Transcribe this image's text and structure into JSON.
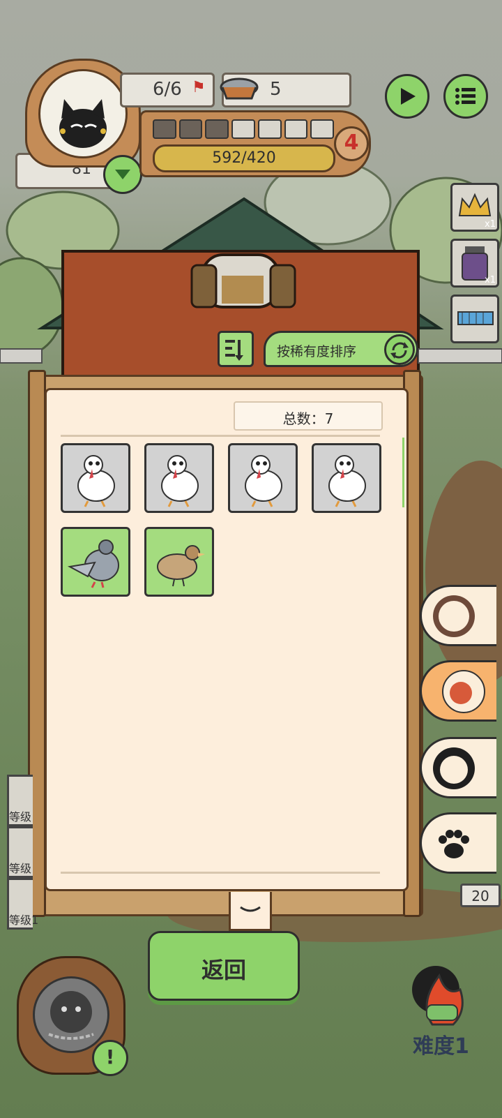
{
  "hud": {
    "flags": "6/6",
    "bowl_count": "5",
    "currency": "81",
    "level_number": "4",
    "xp": "592/420",
    "progress_filled": 3,
    "progress_total": 7
  },
  "side_items": {
    "crown_count": "x1",
    "jar_count": "x1"
  },
  "sort_bar": {
    "label": "按稀有度排序"
  },
  "collection": {
    "total_label": "总数：7",
    "tiles": [
      {
        "animal": "white-chicken",
        "style": "gray"
      },
      {
        "animal": "white-chicken",
        "style": "gray"
      },
      {
        "animal": "white-chicken",
        "style": "gray"
      },
      {
        "animal": "white-chicken",
        "style": "gray"
      },
      {
        "animal": "pigeon",
        "style": "green"
      },
      {
        "animal": "quail",
        "style": "green"
      }
    ]
  },
  "back_button": {
    "label": "返回"
  },
  "difficulty": {
    "label": "难度1"
  },
  "left_levels": {
    "l1": "等级",
    "l2": "等级",
    "l3": "等级1"
  },
  "right_counter": "20",
  "colors": {
    "accent_green": "#8ed36a",
    "panel_bg": "#fdeedc",
    "wood": "#c9a16d"
  }
}
